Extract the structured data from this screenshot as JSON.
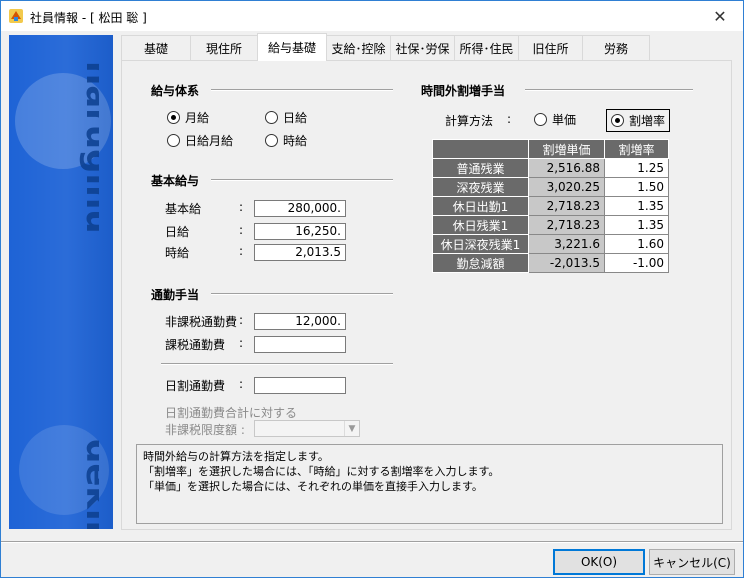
{
  "window": {
    "title": "社員情報 - [ 松田 聡 ]",
    "close_glyph": "✕"
  },
  "tabs": [
    "基礎",
    "現住所",
    "給与基礎",
    "支給･控除",
    "社保･労保",
    "所得･住民",
    "旧住所",
    "労務"
  ],
  "active_tab": 2,
  "salary_system": {
    "title": "給与体系",
    "options": [
      "月給",
      "日給",
      "日給月給",
      "時給"
    ],
    "selected": "月給"
  },
  "base_salary": {
    "title": "基本給与",
    "rows": [
      {
        "label": "基本給",
        "value": "280,000."
      },
      {
        "label": "日給",
        "value": "16,250."
      },
      {
        "label": "時給",
        "value": "2,013.5"
      }
    ]
  },
  "commute": {
    "title": "通勤手当",
    "nontax_label": "非課税通勤費",
    "nontax_value": "12,000.",
    "tax_label": "課税通勤費",
    "tax_value": "",
    "daily_label": "日割通勤費",
    "daily_value": "",
    "limit_label_1": "日割通勤費合計に対する",
    "limit_label_2": "非課税限度額 :"
  },
  "overtime": {
    "title": "時間外割増手当",
    "method_label": "計算方法",
    "method_options": [
      "単価",
      "割増率"
    ],
    "method_selected": "割増率",
    "headers": [
      "割増単価",
      "割増率"
    ],
    "rows": [
      {
        "name": "普通残業",
        "unit": "2,516.88",
        "rate": "1.25"
      },
      {
        "name": "深夜残業",
        "unit": "3,020.25",
        "rate": "1.50"
      },
      {
        "name": "休日出勤1",
        "unit": "2,718.23",
        "rate": "1.35"
      },
      {
        "name": "休日残業1",
        "unit": "2,718.23",
        "rate": "1.35"
      },
      {
        "name": "休日深夜残業1",
        "unit": "3,221.6",
        "rate": "1.60"
      },
      {
        "name": "勤怠減額",
        "unit": "-2,013.5",
        "rate": "-1.00"
      }
    ]
  },
  "help": {
    "line1": "時間外給与の計算方法を指定します。",
    "line2": "「割増率」を選択した場合には、「時給」に対する割増率を入力します。",
    "line3": "「単価」を選択した場合には、それぞれの単価を直接手入力します。"
  },
  "buttons": {
    "ok": "OK(O)",
    "cancel": "キャンセル(C)"
  },
  "sidebar": {
    "brand_top": "naruginu",
    "brand_bottom": "dekirn"
  }
}
